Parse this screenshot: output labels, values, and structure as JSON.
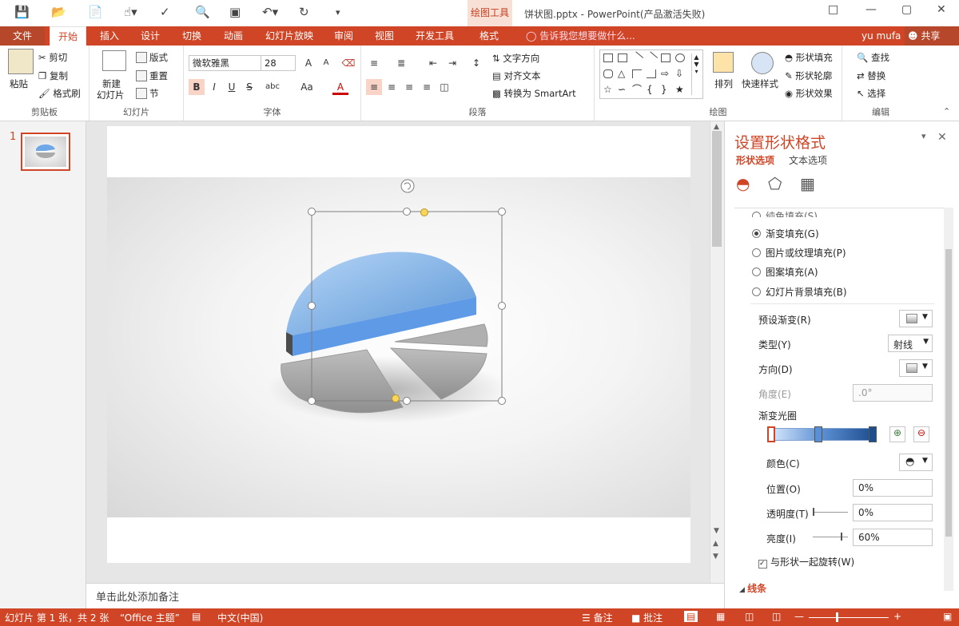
{
  "titlebar": {
    "context_group": "绘图工具",
    "window_title": "饼状图.pptx - PowerPoint(产品激活失败)",
    "user": "yu mufa",
    "share": "共享"
  },
  "tabs": [
    {
      "label": "文件"
    },
    {
      "label": "开始"
    },
    {
      "label": "插入"
    },
    {
      "label": "设计"
    },
    {
      "label": "切换"
    },
    {
      "label": "动画"
    },
    {
      "label": "幻灯片放映"
    },
    {
      "label": "审阅"
    },
    {
      "label": "视图"
    },
    {
      "label": "开发工具"
    },
    {
      "label": "格式"
    }
  ],
  "tell_me": "告诉我您想要做什么...",
  "ribbon": {
    "clipboard": {
      "paste": "粘贴",
      "cut": "剪切",
      "copy": "复制",
      "format_painter": "格式刷",
      "label": "剪贴板"
    },
    "slides": {
      "new_slide_1": "新建",
      "new_slide_2": "幻灯片",
      "layout": "版式",
      "reset": "重置",
      "section": "节",
      "label": "幻灯片"
    },
    "font": {
      "font_name": "微软雅黑",
      "font_size": "28",
      "label": "字体",
      "bold": "B",
      "italic": "I",
      "underline": "U",
      "strike": "S",
      "spacing": "abc",
      "aa": "Aa",
      "color_a": "A",
      "grow": "A",
      "shrink": "A"
    },
    "paragraph": {
      "text_direction": "文字方向",
      "align_text": "对齐文本",
      "smartart": "转换为 SmartArt",
      "label": "段落"
    },
    "drawing": {
      "arrange": "排列",
      "quick_styles": "快速样式",
      "shape_fill": "形状填充",
      "shape_outline": "形状轮廓",
      "shape_effects": "形状效果",
      "label": "绘图"
    },
    "editing": {
      "find": "查找",
      "replace": "替换",
      "select": "选择",
      "label": "编辑"
    }
  },
  "thumbnail": {
    "number": "1"
  },
  "notes_placeholder": "单击此处添加备注",
  "format_pane": {
    "title": "设置形状格式",
    "tabs": [
      "形状选项",
      "文本选项"
    ],
    "fills": [
      {
        "label": "纯色填充(S)",
        "selected": false
      },
      {
        "label": "渐变填充(G)",
        "selected": true
      },
      {
        "label": "图片或纹理填充(P)",
        "selected": false
      },
      {
        "label": "图案填充(A)",
        "selected": false
      },
      {
        "label": "幻灯片背景填充(B)",
        "selected": false
      }
    ],
    "preset_gradient": "预设渐变(R)",
    "type_label": "类型(Y)",
    "type_value": "射线",
    "direction": "方向(D)",
    "angle_label": "角度(E)",
    "angle_value": ".0°",
    "gradient_stops": "渐变光圈",
    "color": "颜色(C)",
    "position_label": "位置(O)",
    "position_value": "0%",
    "transparency_label": "透明度(T)",
    "transparency_value": "0%",
    "brightness_label": "亮度(I)",
    "brightness_value": "60%",
    "rotate_with_shape": "与形状一起旋转(W)",
    "lines": "线条"
  },
  "statusbar": {
    "slide_info": "幻灯片 第 1 张，共 2 张",
    "theme": "“Office 主题”",
    "language": "中文(中国)",
    "notes": "备注",
    "comments": "批注"
  },
  "colors": {
    "accent": "#d04526",
    "pie_blue": "#5b9be0",
    "pie_gray": "#a6a6a6"
  }
}
